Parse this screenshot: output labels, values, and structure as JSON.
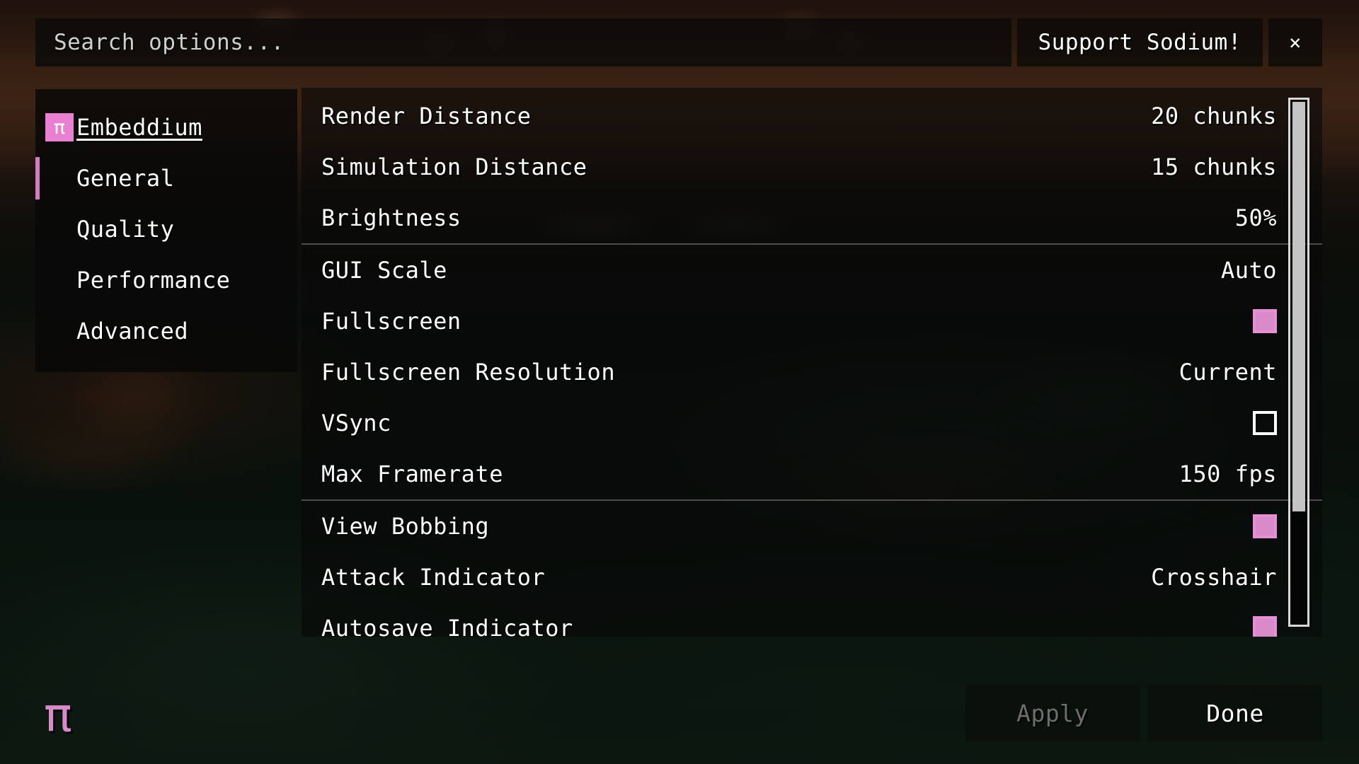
{
  "header": {
    "search_placeholder": "Search options...",
    "support_label": "Support Sodium!",
    "close_label": "×"
  },
  "sidebar": {
    "brand": {
      "icon": "pi-icon",
      "glyph": "π",
      "label": "Embeddium"
    },
    "items": [
      {
        "label": "General",
        "active": true
      },
      {
        "label": "Quality",
        "active": false
      },
      {
        "label": "Performance",
        "active": false
      },
      {
        "label": "Advanced",
        "active": false
      }
    ]
  },
  "options": {
    "groups": [
      {
        "rows": [
          {
            "name": "Render Distance",
            "value": "20 chunks",
            "control": "text"
          },
          {
            "name": "Simulation Distance",
            "value": "15 chunks",
            "control": "text"
          },
          {
            "name": "Brightness",
            "value": "50%",
            "control": "text"
          }
        ]
      },
      {
        "rows": [
          {
            "name": "GUI Scale",
            "value": "Auto",
            "control": "text"
          },
          {
            "name": "Fullscreen",
            "value": "",
            "control": "checkbox",
            "checked": true
          },
          {
            "name": "Fullscreen Resolution",
            "value": "Current",
            "control": "text"
          },
          {
            "name": "VSync",
            "value": "",
            "control": "checkbox",
            "checked": false
          },
          {
            "name": "Max Framerate",
            "value": "150 fps",
            "control": "text"
          }
        ]
      },
      {
        "rows": [
          {
            "name": "View Bobbing",
            "value": "",
            "control": "checkbox",
            "checked": true
          },
          {
            "name": "Attack Indicator",
            "value": "Crosshair",
            "control": "text"
          },
          {
            "name": "Autosave Indicator",
            "value": "",
            "control": "checkbox",
            "checked": true
          }
        ]
      }
    ]
  },
  "footer": {
    "logo_glyph": "π",
    "apply_label": "Apply",
    "apply_enabled": false,
    "done_label": "Done"
  },
  "colors": {
    "accent_pink": "#d98ac8",
    "accent_pink_border": "#e68fd4",
    "brand_badge": "#e87fd0",
    "text": "#ffffff",
    "disabled_text": "#6d6d6d",
    "scrollbar": "#c4c4c4"
  },
  "scrollbar": {
    "thumb_percent": 78
  }
}
